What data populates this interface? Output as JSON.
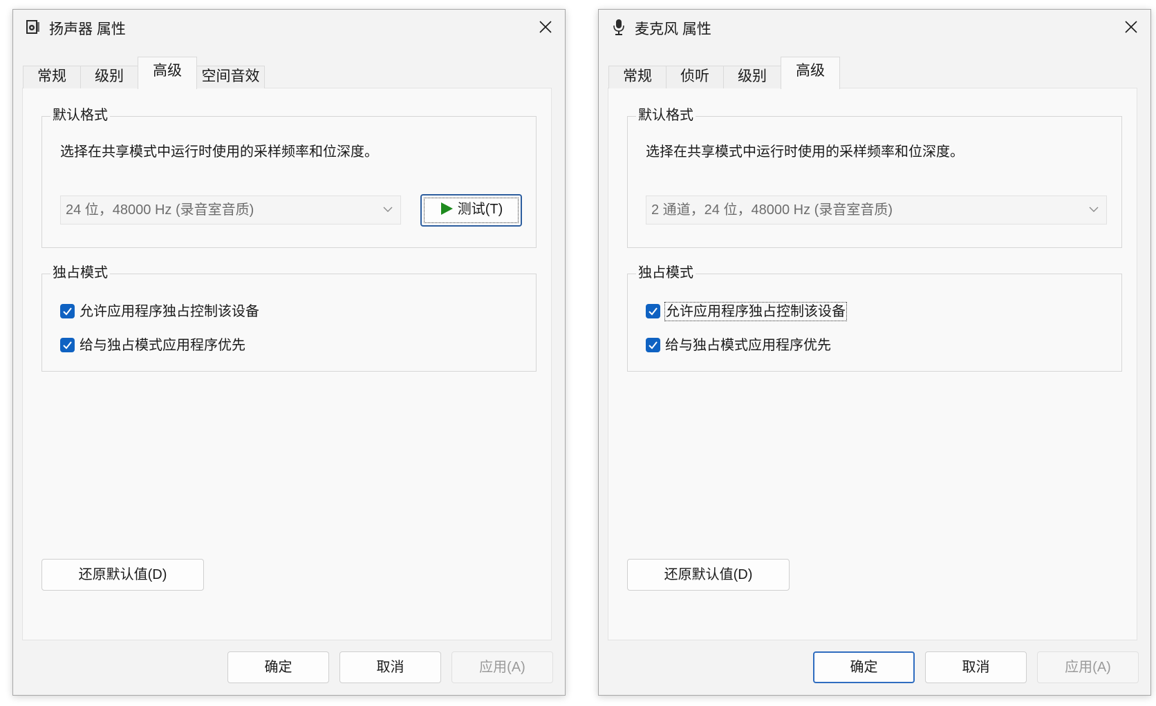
{
  "speaker_dialog": {
    "title": "扬声器 属性",
    "close_icon": "close-icon",
    "tabs": [
      {
        "label": "常规",
        "active": false
      },
      {
        "label": "级别",
        "active": false
      },
      {
        "label": "高级",
        "active": true
      },
      {
        "label": "空间音效",
        "active": false
      }
    ],
    "default_format": {
      "legend": "默认格式",
      "description": "选择在共享模式中运行时使用的采样频率和位深度。",
      "selected_format": "24 位，48000 Hz (录音室音质)",
      "test_button": "测试(T)"
    },
    "exclusive_mode": {
      "legend": "独占模式",
      "allow_exclusive_label": "允许应用程序独占控制该设备",
      "allow_exclusive_checked": true,
      "priority_label": "给与独占模式应用程序优先",
      "priority_checked": true
    },
    "restore_defaults": "还原默认值(D)",
    "ok": "确定",
    "cancel": "取消",
    "apply": "应用(A)"
  },
  "mic_dialog": {
    "title": "麦克风 属性",
    "close_icon": "close-icon",
    "tabs": [
      {
        "label": "常规",
        "active": false
      },
      {
        "label": "侦听",
        "active": false
      },
      {
        "label": "级别",
        "active": false
      },
      {
        "label": "高级",
        "active": true
      }
    ],
    "default_format": {
      "legend": "默认格式",
      "description": "选择在共享模式中运行时使用的采样频率和位深度。",
      "selected_format": "2 通道，24 位，48000 Hz (录音室音质)"
    },
    "exclusive_mode": {
      "legend": "独占模式",
      "allow_exclusive_label": "允许应用程序独占控制该设备",
      "allow_exclusive_checked": true,
      "priority_label": "给与独占模式应用程序优先",
      "priority_checked": true
    },
    "restore_defaults": "还原默认值(D)",
    "ok": "确定",
    "cancel": "取消",
    "apply": "应用(A)"
  },
  "colors": {
    "accent": "#0f62c2",
    "dialog_bg": "#f3f3f3",
    "panel_bg": "#f9f9f9",
    "play_green": "#1e8a1e"
  }
}
